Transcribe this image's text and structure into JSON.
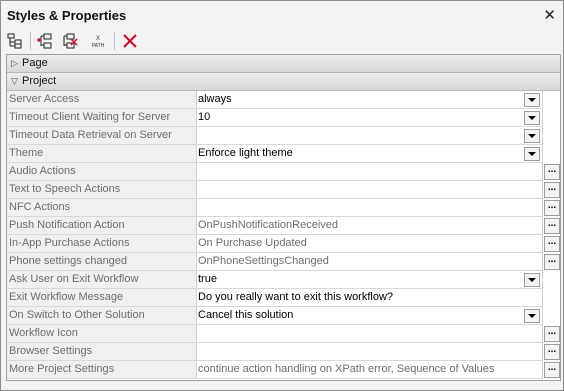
{
  "window": {
    "title": "Styles & Properties",
    "close_label": "✕"
  },
  "toolbar": {
    "path_label_top": "X",
    "path_label_bottom": "PATH"
  },
  "sections": [
    {
      "label": "Page",
      "expanded": false
    },
    {
      "label": "Project",
      "expanded": true
    }
  ],
  "rows": [
    {
      "name": "Server Access",
      "value": "always",
      "control": "dropdown",
      "value_style": "normal"
    },
    {
      "name": "Timeout Client Waiting for Server",
      "value": "10",
      "control": "dropdown",
      "value_style": "normal"
    },
    {
      "name": "Timeout Data Retrieval on Server",
      "value": "",
      "control": "dropdown",
      "value_style": "normal"
    },
    {
      "name": "Theme",
      "value": "Enforce light theme",
      "control": "dropdown",
      "value_style": "normal"
    },
    {
      "name": "Audio Actions",
      "value": "",
      "control": "dialog",
      "value_style": "normal"
    },
    {
      "name": "Text to Speech Actions",
      "value": "",
      "control": "dialog",
      "value_style": "normal"
    },
    {
      "name": "NFC Actions",
      "value": "",
      "control": "dialog",
      "value_style": "normal"
    },
    {
      "name": "Push Notification Action",
      "value": "OnPushNotificationReceived",
      "control": "dialog",
      "value_style": "grey"
    },
    {
      "name": "In-App Purchase Actions",
      "value": "On Purchase Updated",
      "control": "dialog",
      "value_style": "grey"
    },
    {
      "name": "Phone settings changed",
      "value": "OnPhoneSettingsChanged",
      "control": "dialog",
      "value_style": "grey"
    },
    {
      "name": "Ask User on Exit Workflow",
      "value": "true",
      "control": "dropdown",
      "value_style": "normal"
    },
    {
      "name": "Exit Workflow Message",
      "value": "Do you really want to exit this workflow?",
      "control": "none",
      "value_style": "normal"
    },
    {
      "name": "On Switch to Other Solution",
      "value": "Cancel this solution",
      "control": "dropdown",
      "value_style": "normal"
    },
    {
      "name": "Workflow Icon",
      "value": "",
      "control": "dialog",
      "value_style": "normal"
    },
    {
      "name": "Browser Settings",
      "value": "",
      "control": "dialog",
      "value_style": "normal"
    },
    {
      "name": "More Project Settings",
      "value": "continue action handling on XPath error, Sequence of Values",
      "control": "dialog",
      "value_style": "grey"
    }
  ],
  "colors": {
    "delete_icon": "#c8102e",
    "name_text": "#6d6d6d",
    "section_bg": "#dedede"
  }
}
